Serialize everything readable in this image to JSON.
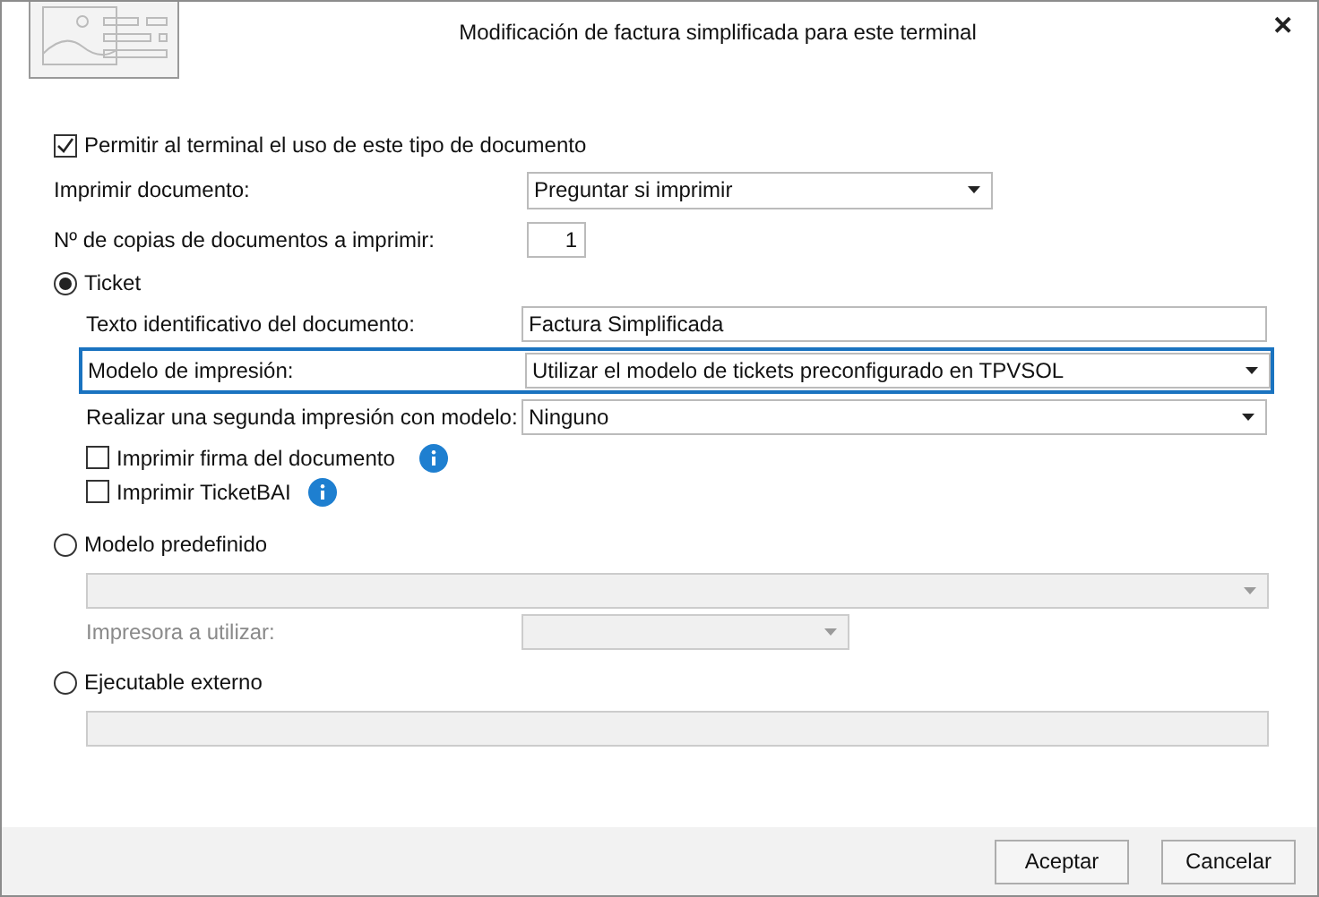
{
  "window": {
    "title": "Modificación de factura simplificada para este terminal",
    "close": "✕"
  },
  "allow": {
    "label": "Permitir al terminal el uso de este tipo de documento",
    "checked": true
  },
  "print_document": {
    "label": "Imprimir documento:",
    "value": "Preguntar si imprimir"
  },
  "copies": {
    "label": "Nº de copias de documentos a imprimir:",
    "value": "1"
  },
  "options": [
    {
      "kind": "ticket",
      "label": "Ticket",
      "selected": true,
      "text_id": {
        "label": "Texto identificativo del documento:",
        "value": "Factura Simplificada"
      },
      "print_model": {
        "label": "Modelo de impresión:",
        "value": "Utilizar el modelo de tickets preconfigurado en TPVSOL",
        "focused": true
      },
      "second_print": {
        "label": "Realizar una segunda impresión con modelo:",
        "value": "Ninguno"
      },
      "checks": [
        {
          "label": "Imprimir firma del documento",
          "checked": false
        },
        {
          "label": "Imprimir TicketBAI",
          "checked": false
        }
      ]
    },
    {
      "kind": "predefined",
      "label": "Modelo predefinido",
      "selected": false,
      "printer_label": "Impresora a utilizar:",
      "disabled": true
    },
    {
      "kind": "external",
      "label": "Ejecutable externo",
      "selected": false,
      "disabled": true
    }
  ],
  "buttons": [
    "Aceptar",
    "Cancelar"
  ]
}
